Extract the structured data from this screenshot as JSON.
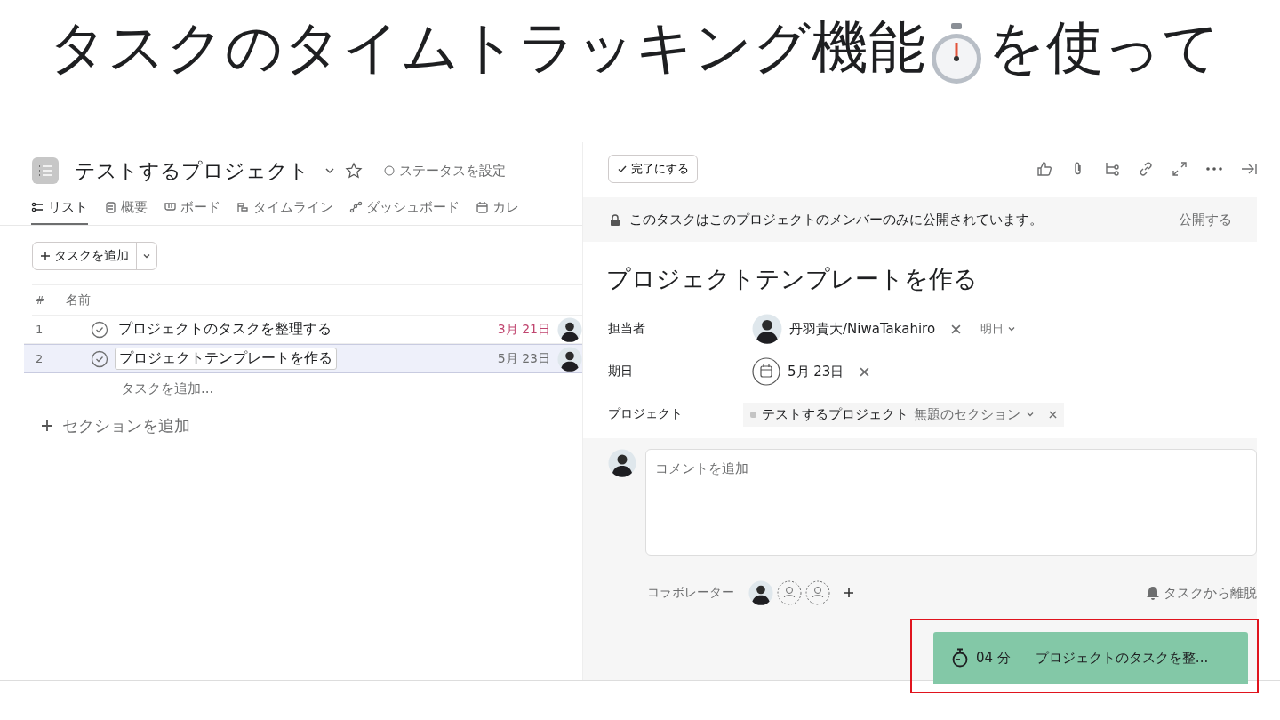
{
  "headline": {
    "before": "タスクのタイムトラッキング機能",
    "after": "を使って"
  },
  "project": {
    "title": "テストするプロジェクト",
    "status": "ステータスを設定"
  },
  "tabs": [
    {
      "label": "リスト",
      "selected": true
    },
    {
      "label": "概要",
      "selected": false
    },
    {
      "label": "ボード",
      "selected": false
    },
    {
      "label": "タイムライン",
      "selected": false
    },
    {
      "label": "ダッシュボード",
      "selected": false
    },
    {
      "label": "カレ",
      "selected": false
    }
  ],
  "add_task_button": "タスクを追加",
  "table": {
    "columns": [
      "#",
      "名前"
    ],
    "rows": [
      {
        "number": "1",
        "name": "プロジェクトのタスクを整理する",
        "due": "3月 21日",
        "overdue": true,
        "selected": false
      },
      {
        "number": "2",
        "name": "プロジェクトテンプレートを作る",
        "due": "5月 23日",
        "overdue": false,
        "selected": true
      }
    ],
    "add_task": "タスクを追加..."
  },
  "add_section": "セクションを追加",
  "detail": {
    "complete_button": "完了にする",
    "privacy_notice": "このタスクはこのプロジェクトのメンバーのみに公開されています。",
    "make_public": "公開する",
    "title": "プロジェクトテンプレートを作る",
    "fields": [
      {
        "label": "担当者",
        "kind": "assignee",
        "value": "丹羽貴大/NiwaTakahiro",
        "extra": "明日"
      },
      {
        "label": "期日",
        "kind": "date",
        "value": "5月 23日"
      },
      {
        "label": "プロジェクト",
        "kind": "project",
        "value": "テストするプロジェクト",
        "extra": "無題のセクション"
      }
    ],
    "comment": {
      "placeholder": "コメントを追加"
    },
    "collaborators": {
      "label": "コラボレーター"
    },
    "leave": "タスクから離脱"
  },
  "timer": {
    "time": "04 分",
    "task": "プロジェクトのタスクを整..."
  }
}
